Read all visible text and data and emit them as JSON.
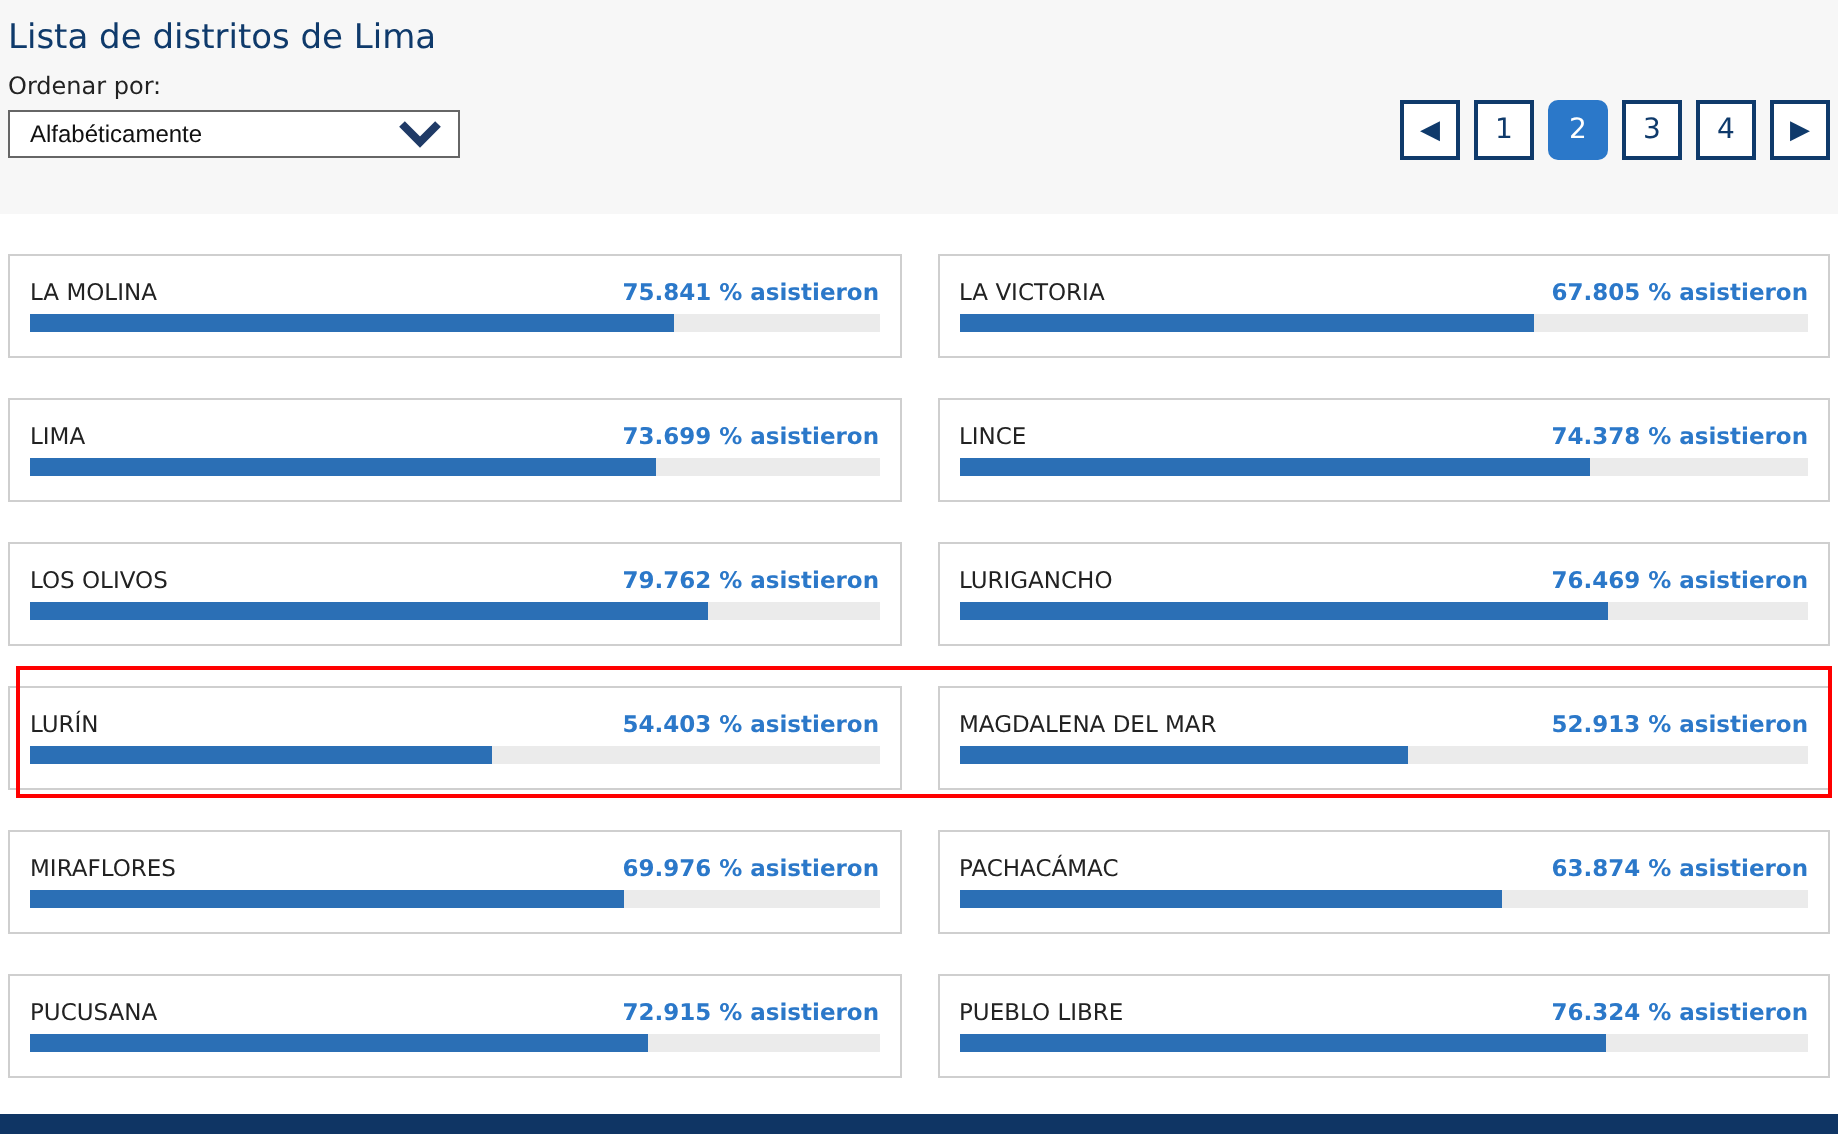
{
  "title": "Lista de distritos de Lima",
  "sort": {
    "label": "Ordenar por:",
    "value": "Alfabéticamente"
  },
  "pagination": [
    {
      "label": "◀",
      "kind": "arrow",
      "selected": false
    },
    {
      "label": "1",
      "kind": "page",
      "selected": false
    },
    {
      "label": "2",
      "kind": "page",
      "selected": true
    },
    {
      "label": "3",
      "kind": "page",
      "selected": false
    },
    {
      "label": "4",
      "kind": "page",
      "selected": false
    },
    {
      "label": "▶",
      "kind": "arrow",
      "selected": false
    }
  ],
  "rows": [
    {
      "highlighted": false,
      "districts": [
        {
          "name": "LA MOLINA",
          "reading": "75.841 % asistieron",
          "level": 0.758
        },
        {
          "name": "LA VICTORIA",
          "reading": "67.805 % asistieron",
          "level": 0.678
        }
      ]
    },
    {
      "highlighted": false,
      "districts": [
        {
          "name": "LIMA",
          "reading": "73.699 % asistieron",
          "level": 0.737
        },
        {
          "name": "LINCE",
          "reading": "74.378 % asistieron",
          "level": 0.744
        }
      ]
    },
    {
      "highlighted": false,
      "districts": [
        {
          "name": "LOS OLIVOS",
          "reading": "79.762 % asistieron",
          "level": 0.798
        },
        {
          "name": "LURIGANCHO",
          "reading": "76.469 % asistieron",
          "level": 0.765
        }
      ]
    },
    {
      "highlighted": true,
      "districts": [
        {
          "name": "LURÍN",
          "reading": "54.403 % asistieron",
          "level": 0.544
        },
        {
          "name": "MAGDALENA DEL MAR",
          "reading": "52.913 % asistieron",
          "level": 0.529
        }
      ]
    },
    {
      "highlighted": false,
      "districts": [
        {
          "name": "MIRAFLORES",
          "reading": "69.976 % asistieron",
          "level": 0.7
        },
        {
          "name": "PACHACÁMAC",
          "reading": "63.874 % asistieron",
          "level": 0.639
        }
      ]
    },
    {
      "highlighted": false,
      "districts": [
        {
          "name": "PUCUSANA",
          "reading": "72.915 % asistieron",
          "level": 0.729
        },
        {
          "name": "PUEBLO LIBRE",
          "reading": "76.324 % asistieron",
          "level": 0.763
        }
      ]
    }
  ]
}
